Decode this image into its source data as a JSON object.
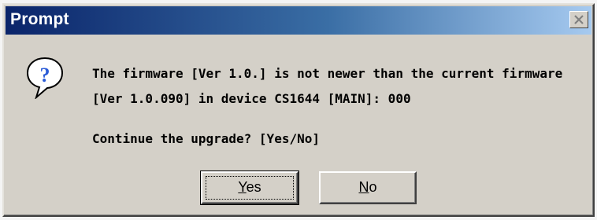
{
  "dialog": {
    "title": "Prompt",
    "close_icon": "close-icon",
    "icon": "question-icon",
    "message_line1": "The firmware [Ver 1.0.] is not newer than the current firmware",
    "message_line2": "[Ver 1.0.090] in device CS1644 [MAIN]: 000",
    "question": "Continue the upgrade? [Yes/No]",
    "buttons": {
      "yes": {
        "mnemonic": "Y",
        "rest": "es"
      },
      "no": {
        "mnemonic": "N",
        "rest": "o"
      }
    }
  },
  "colors": {
    "titlebar_start": "#0a246a",
    "titlebar_end": "#a6caf0",
    "face": "#d4d0c8",
    "icon_blue": "#2a5bd7"
  }
}
